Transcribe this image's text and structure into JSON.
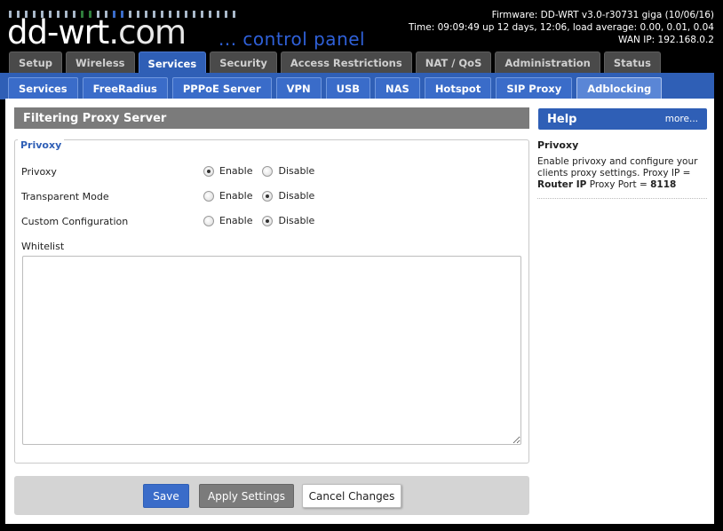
{
  "header": {
    "logo_text": "dd-wrt",
    "logo_com": ".com",
    "subtitle": "... control panel",
    "firmware": "Firmware: DD-WRT v3.0-r30731 giga (10/06/16)",
    "time": "Time: 09:09:49 up 12 days, 12:06, load average: 0.00, 0.01, 0.04",
    "wan_ip": "WAN IP: 192.168.0.2"
  },
  "main_tabs": [
    {
      "label": "Setup",
      "active": false
    },
    {
      "label": "Wireless",
      "active": false
    },
    {
      "label": "Services",
      "active": true
    },
    {
      "label": "Security",
      "active": false
    },
    {
      "label": "Access Restrictions",
      "active": false
    },
    {
      "label": "NAT / QoS",
      "active": false
    },
    {
      "label": "Administration",
      "active": false
    },
    {
      "label": "Status",
      "active": false
    }
  ],
  "sub_tabs": [
    {
      "label": "Services",
      "active": false
    },
    {
      "label": "FreeRadius",
      "active": false
    },
    {
      "label": "PPPoE Server",
      "active": false
    },
    {
      "label": "VPN",
      "active": false
    },
    {
      "label": "USB",
      "active": false
    },
    {
      "label": "NAS",
      "active": false
    },
    {
      "label": "Hotspot",
      "active": false
    },
    {
      "label": "SIP Proxy",
      "active": false
    },
    {
      "label": "Adblocking",
      "active": true
    }
  ],
  "section": {
    "title": "Filtering Proxy Server",
    "legend": "Privoxy",
    "rows": [
      {
        "label": "Privoxy",
        "enable": "Enable",
        "disable": "Disable",
        "selected": "enable"
      },
      {
        "label": "Transparent Mode",
        "enable": "Enable",
        "disable": "Disable",
        "selected": "disable"
      },
      {
        "label": "Custom Configuration",
        "enable": "Enable",
        "disable": "Disable",
        "selected": "disable"
      }
    ],
    "whitelist_label": "Whitelist",
    "whitelist_value": ""
  },
  "buttons": {
    "save": "Save",
    "apply": "Apply Settings",
    "cancel": "Cancel Changes"
  },
  "help": {
    "title": "Help",
    "more": "more...",
    "heading": "Privoxy",
    "text_1": "Enable privoxy and configure your clients proxy settings. Proxy IP = ",
    "bold_1": "Router IP",
    "text_2": " Proxy Port = ",
    "bold_2": "8118"
  },
  "colors": {
    "accent_blue": "#2f5fb6",
    "tab_gray": "#4a4a4a",
    "section_gray": "#7b7b7b"
  }
}
